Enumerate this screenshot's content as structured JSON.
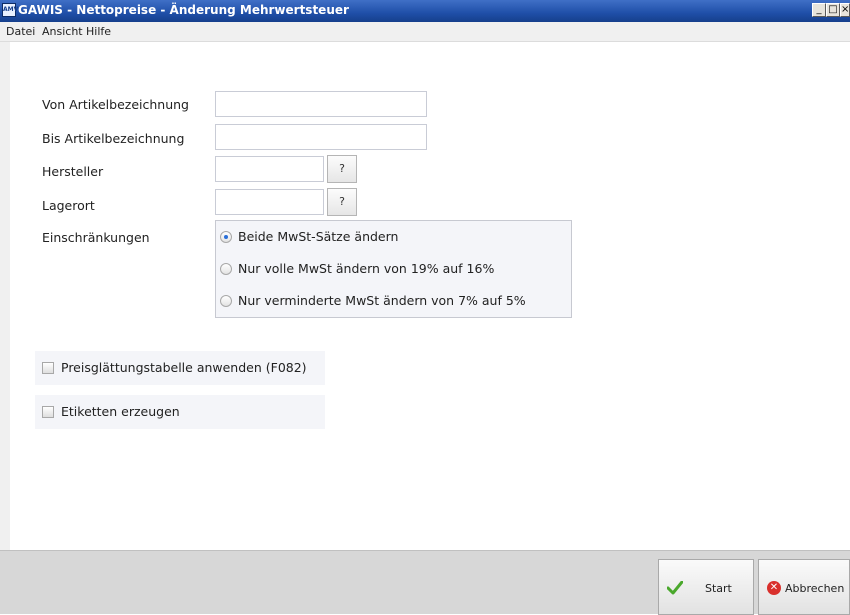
{
  "window": {
    "title": "GAWIS - Nettopreise - Änderung Mehrwertsteuer",
    "logo_text": "AMV",
    "minimize_glyph": "_",
    "maximize_glyph": "□",
    "close_glyph": "×"
  },
  "menu": {
    "items": [
      "Datei",
      "Ansicht",
      "Hilfe"
    ]
  },
  "form": {
    "von_label": "Von Artikelbezeichnung",
    "von_value": "",
    "bis_label": "Bis Artikelbezeichnung",
    "bis_value": "",
    "hersteller_label": "Hersteller",
    "hersteller_value": "",
    "hersteller_lookup": "?",
    "lagerort_label": "Lagerort",
    "lagerort_value": "",
    "lagerort_lookup": "?",
    "einschraenkungen_label": "Einschränkungen",
    "options": [
      {
        "label": "Beide MwSt-Sätze ändern",
        "checked": true
      },
      {
        "label": "Nur volle MwSt ändern von 19% auf 16%",
        "checked": false
      },
      {
        "label": "Nur verminderte MwSt ändern von 7% auf 5%",
        "checked": false
      }
    ],
    "checkbox_preis": {
      "label": "Preisglättungstabelle anwenden (F082)",
      "checked": false
    },
    "checkbox_etiketten": {
      "label": "Etiketten erzeugen",
      "checked": false
    }
  },
  "footer": {
    "start_label": "Start",
    "cancel_label": "Abbrechen"
  },
  "colors": {
    "titlebar": "#1f4fa8",
    "accent": "#2a6fd8",
    "panel": "#f4f5f9"
  }
}
